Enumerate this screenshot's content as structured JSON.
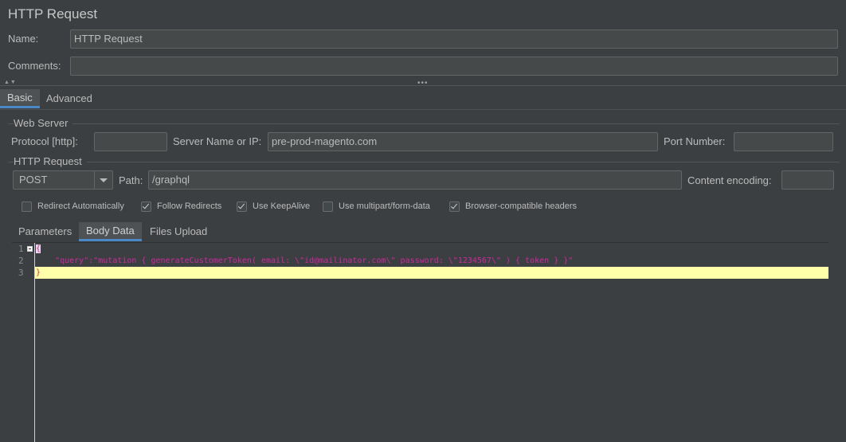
{
  "window": {
    "title": "HTTP Request"
  },
  "fields": {
    "name_label": "Name:",
    "name_value": "HTTP Request",
    "comments_label": "Comments:",
    "comments_value": ""
  },
  "tabs": {
    "basic": "Basic",
    "advanced": "Advanced",
    "active": "Basic"
  },
  "web_server": {
    "group_title": "Web Server",
    "protocol_label": "Protocol [http]:",
    "protocol_value": "",
    "server_label": "Server Name or IP:",
    "server_value": "pre-prod-magento.com",
    "port_label": "Port Number:",
    "port_value": ""
  },
  "http_request": {
    "group_title": "HTTP Request",
    "method": "POST",
    "path_label": "Path:",
    "path_value": "/graphql",
    "encoding_label": "Content encoding:",
    "encoding_value": ""
  },
  "options": [
    {
      "label": "Redirect Automatically",
      "checked": false
    },
    {
      "label": "Follow Redirects",
      "checked": true
    },
    {
      "label": "Use KeepAlive",
      "checked": true
    },
    {
      "label": "Use multipart/form-data",
      "checked": false
    },
    {
      "label": "Browser-compatible headers",
      "checked": true
    }
  ],
  "sub_tabs": {
    "parameters": "Parameters",
    "body_data": "Body Data",
    "files_upload": "Files Upload",
    "active": "Body Data"
  },
  "editor": {
    "line_numbers": [
      "1",
      "2",
      "3"
    ],
    "line1": "{",
    "line2": "    \"query\":\"mutation { generateCustomerToken( email: \\\"id@mailinator.com\\\" password: \\\"1234567\\\" ) { token } }\"",
    "line3": "}",
    "colors": {
      "brace": "#cc3344",
      "string": "#cc2a9e",
      "current_line": "#ffffaa"
    }
  }
}
